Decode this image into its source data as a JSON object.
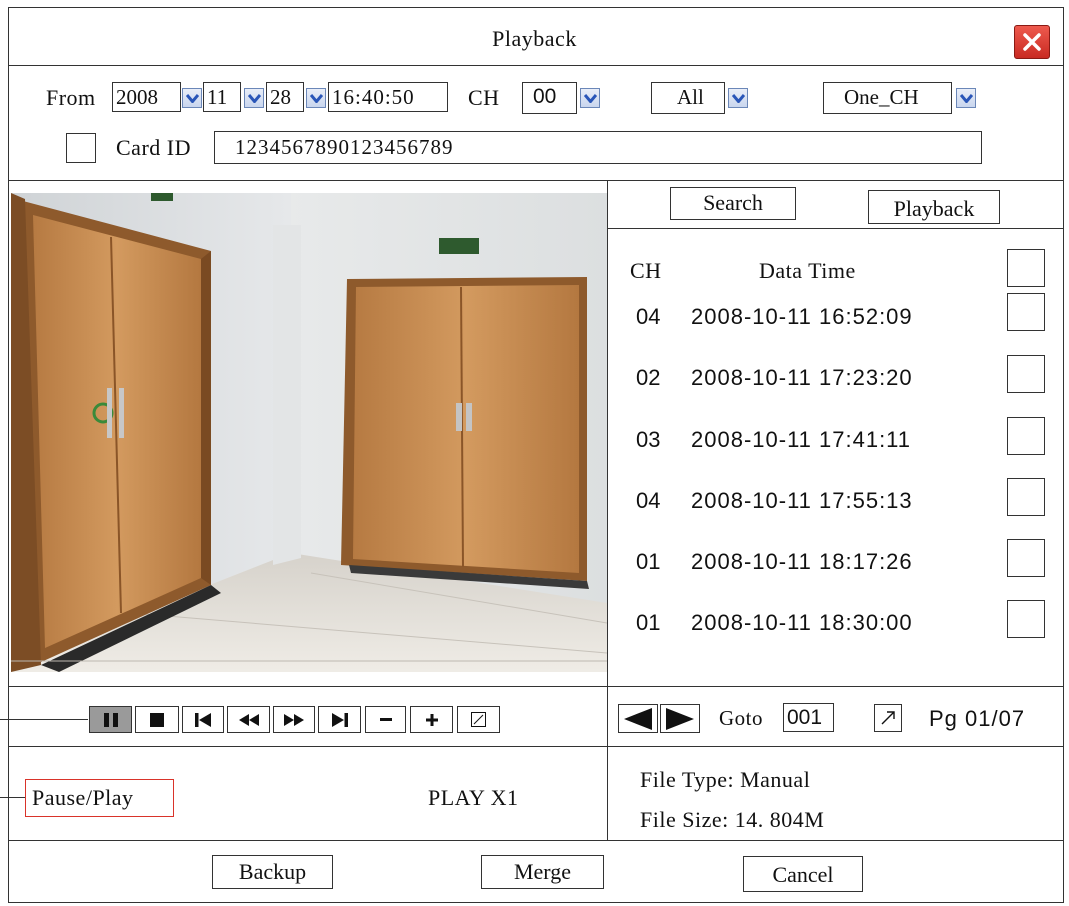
{
  "window": {
    "title": "Playback",
    "close_icon": "close-icon"
  },
  "filter": {
    "from_label": "From",
    "year": "2008",
    "month": "11",
    "day": "28",
    "time": "16:40:50",
    "ch_label": "CH",
    "ch_value": "00",
    "type_value": "All",
    "mode_value": "One_CH",
    "card_label": "Card ID",
    "card_value": "1234567890123456789"
  },
  "actions": {
    "search": "Search",
    "playback": "Playback"
  },
  "list": {
    "header_ch": "CH",
    "header_time": "Data Time",
    "rows": [
      {
        "ch": "04",
        "datetime": "2008-10-11 16:52:09"
      },
      {
        "ch": "02",
        "datetime": "2008-10-11 17:23:20"
      },
      {
        "ch": "03",
        "datetime": "2008-10-11 17:41:11"
      },
      {
        "ch": "04",
        "datetime": "2008-10-11 17:55:13"
      },
      {
        "ch": "01",
        "datetime": "2008-10-11 18:17:26"
      },
      {
        "ch": "01",
        "datetime": "2008-10-11 18:30:00"
      }
    ]
  },
  "controls": [
    "pause-icon",
    "stop-icon",
    "skip-start-icon",
    "rewind-icon",
    "fast-forward-icon",
    "skip-end-icon",
    "minus-icon",
    "plus-icon",
    "fullscreen-icon"
  ],
  "pager": {
    "goto_label": "Goto",
    "goto_value": "001",
    "page": "Pg 01/07"
  },
  "status": {
    "callout": "Pause/Play",
    "speed": "PLAY X1"
  },
  "file_info": {
    "type": "File Type: Manual",
    "size": "File Size: 14. 804M"
  },
  "footer": {
    "backup": "Backup",
    "merge": "Merge",
    "cancel": "Cancel"
  },
  "colors": {
    "close_red": "#e0322c",
    "callout_red": "#d9332a",
    "active_ctrl": "#9a9a9a",
    "dropdown": "#2a56b8"
  }
}
